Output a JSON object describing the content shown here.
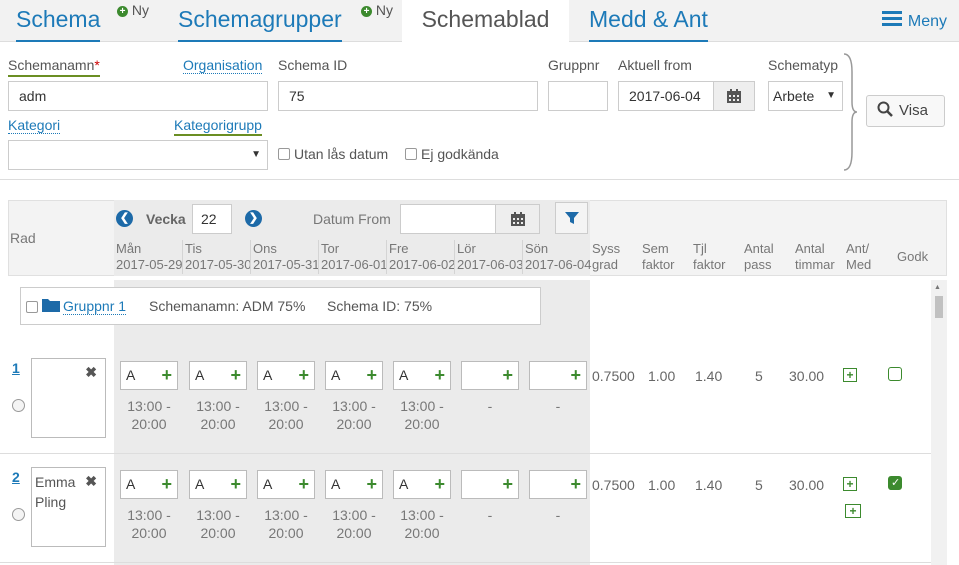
{
  "nav": {
    "tab_schema": "Schema",
    "ny1": "Ny",
    "tab_schemagrupper": "Schemagrupper",
    "ny2": "Ny",
    "tab_schemablad": "Schemablad",
    "tab_medd": "Medd & Ant",
    "menu": "Meny"
  },
  "filters": {
    "schemanamn_label": "Schemanamn",
    "required_mark": "*",
    "organisation_label": "Organisation",
    "schemanamn_value": "adm",
    "schema_id_label": "Schema ID",
    "schema_id_value": "75",
    "gruppnr_label": "Gruppnr",
    "gruppnr_value": "",
    "aktuell_from_label": "Aktuell from",
    "aktuell_from_value": "2017-06-04",
    "schematyp_label": "Schematyp",
    "schematyp_value": "Arbete",
    "kategori_label": "Kategori",
    "kategorigrupp_label": "Kategorigrupp",
    "kategori_value": "",
    "utan_las_datum": "Utan lås datum",
    "ej_godkanda": "Ej godkända",
    "visa": "Visa"
  },
  "table": {
    "rad_label": "Rad",
    "vecka_label": "Vecka",
    "vecka_value": "22",
    "datum_from_label": "Datum From",
    "datum_from_value": "",
    "days": [
      {
        "name": "Mån",
        "date": "2017-05-29"
      },
      {
        "name": "Tis",
        "date": "2017-05-30"
      },
      {
        "name": "Ons",
        "date": "2017-05-31"
      },
      {
        "name": "Tor",
        "date": "2017-06-01"
      },
      {
        "name": "Fre",
        "date": "2017-06-02"
      },
      {
        "name": "Lör",
        "date": "2017-06-03"
      },
      {
        "name": "Sön",
        "date": "2017-06-04"
      }
    ],
    "cols": {
      "syss1": "Syss",
      "syss2": "grad",
      "sem1": "Sem",
      "sem2": "faktor",
      "tjl1": "Tjl",
      "tjl2": "faktor",
      "antal1": "Antal",
      "antal2": "pass",
      "tim1": "Antal",
      "tim2": "timmar",
      "antmed1": "Ant/",
      "antmed2": "Med",
      "godk": "Godk"
    },
    "group": {
      "link": "Gruppnr 1",
      "schemanamn": "Schemanamn: ADM 75%",
      "schema_id": "Schema ID: 75%"
    },
    "rows": [
      {
        "no": "1",
        "name": "",
        "shifts": [
          "A",
          "A",
          "A",
          "A",
          "A",
          "",
          ""
        ],
        "times": [
          [
            "13:00 -",
            "20:00"
          ],
          [
            "13:00 -",
            "20:00"
          ],
          [
            "13:00 -",
            "20:00"
          ],
          [
            "13:00 -",
            "20:00"
          ],
          [
            "13:00 -",
            "20:00"
          ],
          [
            "-",
            ""
          ],
          [
            "-",
            ""
          ]
        ],
        "syss": "0.7500",
        "sem": "1.00",
        "tjl": "1.40",
        "pass": "5",
        "timmar": "30.00",
        "godk": false
      },
      {
        "no": "2",
        "name": "Emma Pling",
        "shifts": [
          "A",
          "A",
          "A",
          "A",
          "A",
          "",
          ""
        ],
        "times": [
          [
            "13:00 -",
            "20:00"
          ],
          [
            "13:00 -",
            "20:00"
          ],
          [
            "13:00 -",
            "20:00"
          ],
          [
            "13:00 -",
            "20:00"
          ],
          [
            "13:00 -",
            "20:00"
          ],
          [
            "-",
            ""
          ],
          [
            "-",
            ""
          ]
        ],
        "syss": "0.7500",
        "sem": "1.00",
        "tjl": "1.40",
        "pass": "5",
        "timmar": "30.00",
        "godk": true
      }
    ]
  },
  "colors": {
    "link": "#1d7ab8",
    "green": "#3c8a2e"
  }
}
